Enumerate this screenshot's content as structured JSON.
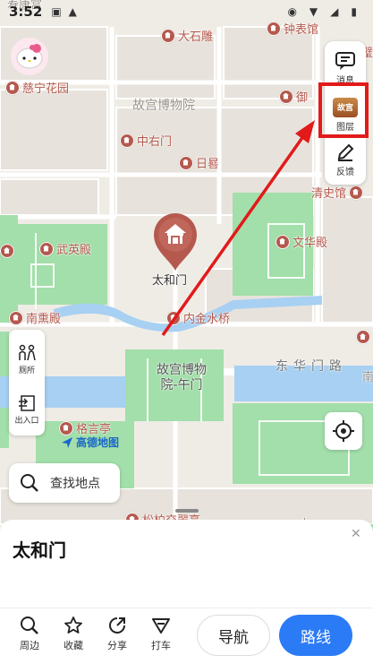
{
  "status_bar": {
    "time": "3:52"
  },
  "top_cut_label": "寿康宫",
  "map": {
    "street_labels": [
      "东华门路"
    ],
    "pois": [
      {
        "id": "dashigao",
        "label": "大石雕"
      },
      {
        "id": "zhongbiaoguan",
        "label": "钟表馆"
      },
      {
        "id": "bi",
        "label": "璧"
      },
      {
        "id": "cininghuayuan",
        "label": "慈宁花园"
      },
      {
        "id": "gugong",
        "label": "故宫博物院"
      },
      {
        "id": "yu",
        "label": "御"
      },
      {
        "id": "zhongyoumen",
        "label": "中右门"
      },
      {
        "id": "rigui",
        "label": "日晷"
      },
      {
        "id": "qingshiguan",
        "label": "清史馆"
      },
      {
        "id": "wuyingdian",
        "label": "武英殿"
      },
      {
        "id": "wenhuadian",
        "label": "文华殿"
      },
      {
        "id": "nanxundian",
        "label": "南熏殿"
      },
      {
        "id": "neijinshuiqiao",
        "label": "内金水桥"
      },
      {
        "id": "wumen",
        "label": "故宫博物院-午门"
      },
      {
        "id": "geyanting",
        "label": "格言亭"
      },
      {
        "id": "songbo",
        "label": "松柏交翠亭"
      },
      {
        "id": "nan",
        "label": "南"
      },
      {
        "id": "shi",
        "label": "十"
      }
    ],
    "selected_place": "太和门"
  },
  "right_panel": {
    "items": [
      {
        "label": "消息",
        "icon": "message-icon"
      },
      {
        "label": "图层",
        "icon": "layer-icon",
        "thumb_text": "故宫"
      },
      {
        "label": "反馈",
        "icon": "edit-icon"
      }
    ]
  },
  "left_panel": {
    "items": [
      {
        "label": "厕所",
        "icon": "toilet-icon"
      },
      {
        "label": "出入口",
        "icon": "entrance-icon"
      }
    ]
  },
  "brand": "高德地图",
  "search": {
    "placeholder": "查找地点"
  },
  "sheet": {
    "place_name": "太和门"
  },
  "bottom_bar": {
    "items": [
      {
        "label": "周边",
        "icon": "search-icon"
      },
      {
        "label": "收藏",
        "icon": "star-icon"
      },
      {
        "label": "分享",
        "icon": "share-icon"
      },
      {
        "label": "打车",
        "icon": "taxi-icon"
      }
    ],
    "nav_label": "导航",
    "route_label": "路线"
  },
  "colors": {
    "accent": "#2b7bf6",
    "poi": "#b5594e",
    "highlight": "#e21a1a",
    "water": "#a9d2f2",
    "green": "#9fdca9"
  }
}
